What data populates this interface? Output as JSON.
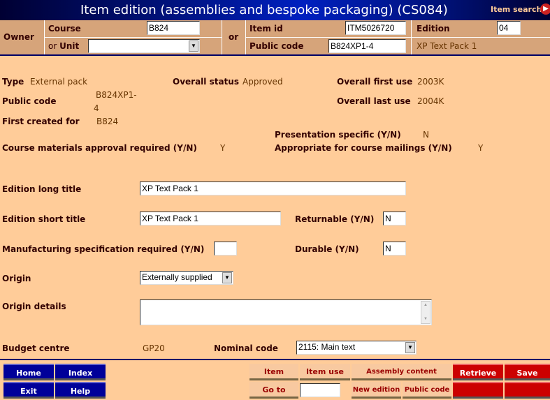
{
  "title": "Item edition (assemblies and bespoke packaging) (CS084)",
  "item_search": "Item search",
  "header": {
    "owner": "Owner",
    "course_label": "Course",
    "course_value": "B824",
    "unit_label_or": "or ",
    "unit_label": "Unit",
    "unit_value": "",
    "or": "or",
    "item_id_label": "Item id",
    "item_id_value": "ITM5026720",
    "edition_label": "Edition",
    "edition_value": "04",
    "public_code_label": "Public code",
    "public_code_value": "B824XP1-4",
    "edition_title": "XP Text Pack 1"
  },
  "info": {
    "type_label": "Type",
    "type_value": "External pack",
    "status_label": "Overall status",
    "status_value": "Approved",
    "first_use_label": "Overall first use",
    "first_use_value": "2003K",
    "public_code_label": "Public code",
    "public_code_value1": "B824XP1-",
    "public_code_value2": "4",
    "last_use_label": "Overall last use",
    "last_use_value": "2004K",
    "first_created_label": "First created for",
    "first_created_value": "B824",
    "presentation_label": "Presentation specific (Y/N)",
    "presentation_value": "N",
    "approval_label": "Course materials approval required (Y/N)",
    "approval_value": "Y",
    "mailings_label": "Appropriate for course mailings (Y/N)",
    "mailings_value": "Y"
  },
  "form": {
    "long_title_label": "Edition long title",
    "long_title_value": "XP Text Pack 1",
    "short_title_label": "Edition short title",
    "short_title_value": "XP Text Pack 1",
    "returnable_label": "Returnable (Y/N)",
    "returnable_value": "N",
    "manuf_label": "Manufacturing specification required (Y/N)",
    "manuf_value": "",
    "durable_label": "Durable (Y/N)",
    "durable_value": "N",
    "origin_label": "Origin",
    "origin_value": "Externally supplied",
    "origin_details_label": "Origin details",
    "origin_details_value": "",
    "budget_label": "Budget centre",
    "budget_value": "GP20",
    "nominal_label": "Nominal code",
    "nominal_value": "2115: Main text"
  },
  "footer": {
    "home": "Home",
    "index": "Index",
    "exit": "Exit",
    "help": "Help",
    "item": "Item",
    "item_use": "Item use",
    "assembly": "Assembly content",
    "retrieve": "Retrieve",
    "save": "Save",
    "goto": "Go to",
    "goto_value": "",
    "new_edition": "New edition",
    "public_code": "Public code"
  }
}
